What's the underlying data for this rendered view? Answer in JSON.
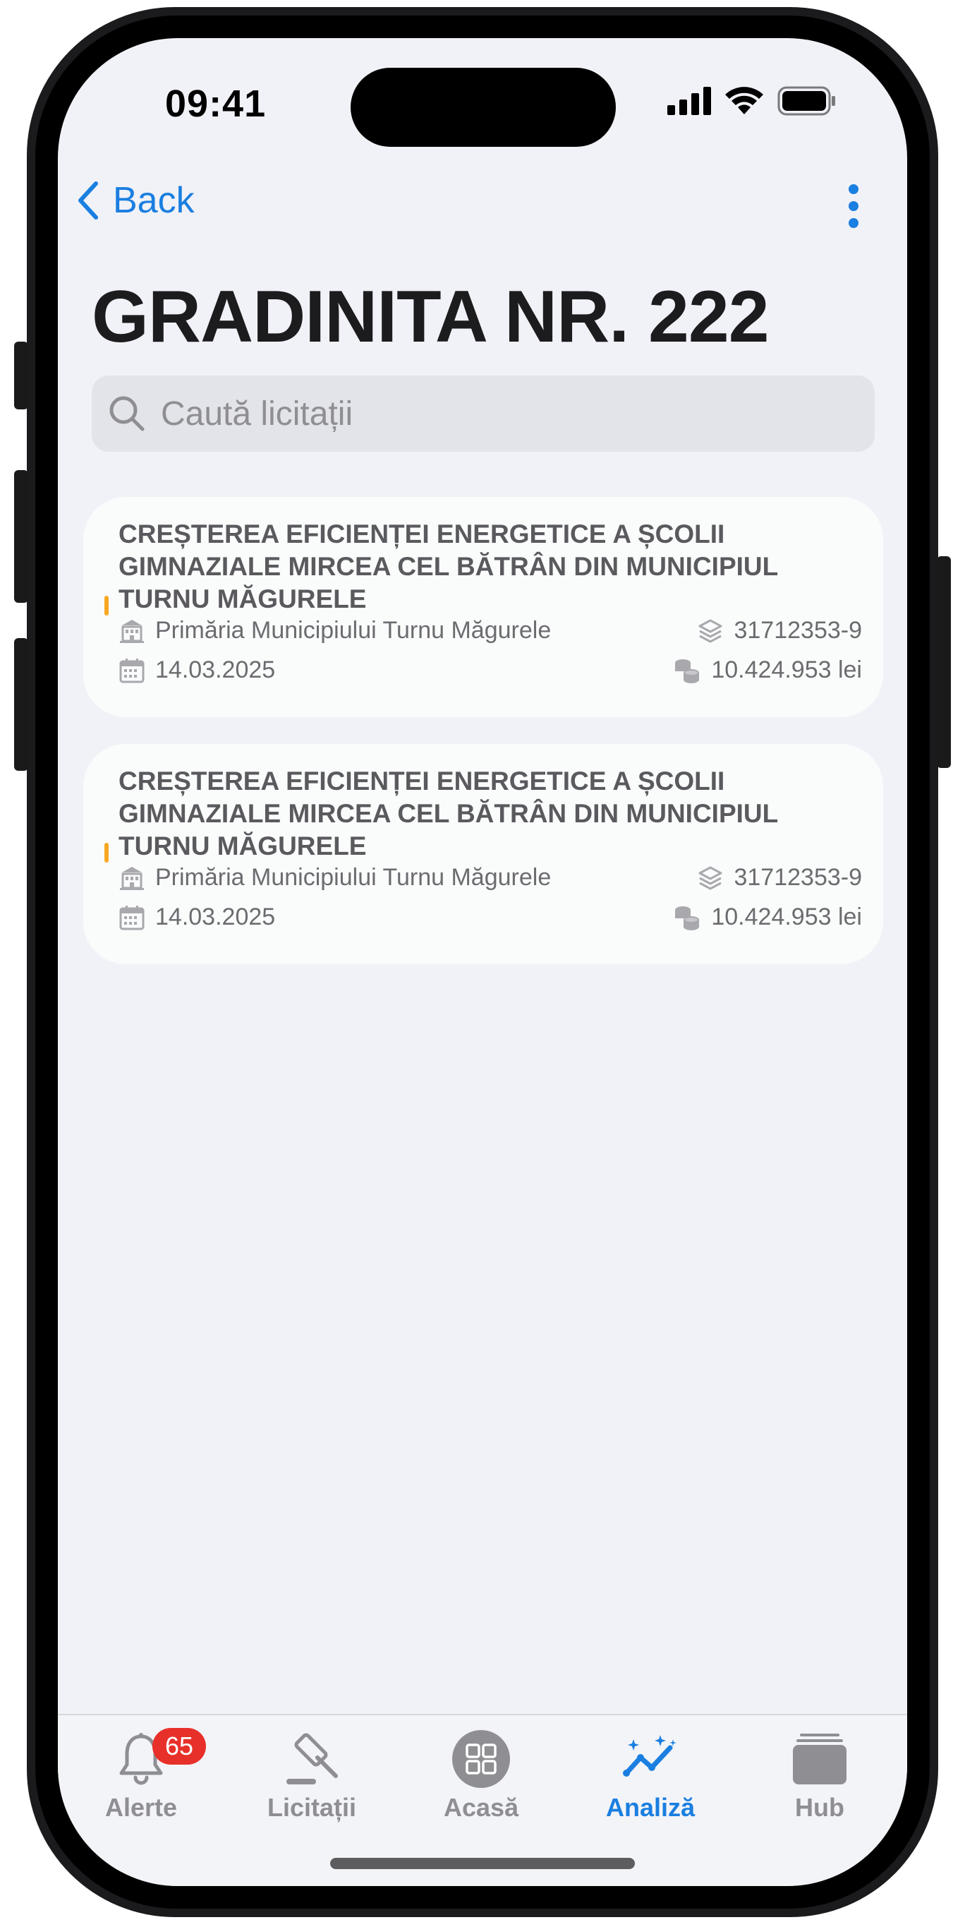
{
  "status_bar": {
    "time": "09:41"
  },
  "nav": {
    "back_label": "Back"
  },
  "page": {
    "title": "GRADINITA NR. 222"
  },
  "search": {
    "placeholder": "Caută licitații",
    "value": ""
  },
  "tenders": [
    {
      "title": "CREȘTEREA EFICIENȚEI ENERGETICE A ȘCOLII GIMNAZIALE MIRCEA CEL BĂTRÂN DIN MUNICIPIUL TURNU MĂGURELE",
      "authority": "Primăria Municipiului Turnu Măgurele",
      "code": "31712353-9",
      "date": "14.03.2025",
      "value": "10.424.953 lei",
      "accent_color": "#f7a823"
    },
    {
      "title": "CREȘTEREA EFICIENȚEI ENERGETICE A ȘCOLII GIMNAZIALE MIRCEA CEL BĂTRÂN DIN MUNICIPIUL TURNU MĂGURELE",
      "authority": "Primăria Municipiului Turnu Măgurele",
      "code": "31712353-9",
      "date": "14.03.2025",
      "value": "10.424.953 lei",
      "accent_color": "#f7a823"
    }
  ],
  "tabbar": {
    "items": [
      {
        "label": "Alerte",
        "icon": "bell-icon",
        "badge": "65"
      },
      {
        "label": "Licitații",
        "icon": "gavel-icon"
      },
      {
        "label": "Acasă",
        "icon": "grid-icon"
      },
      {
        "label": "Analiză",
        "icon": "analytics-icon",
        "active": true
      },
      {
        "label": "Hub",
        "icon": "folder-icon"
      }
    ]
  },
  "colors": {
    "accent": "#1a7fe0",
    "badge": "#e8302a",
    "tender_accent": "#f7a823"
  }
}
